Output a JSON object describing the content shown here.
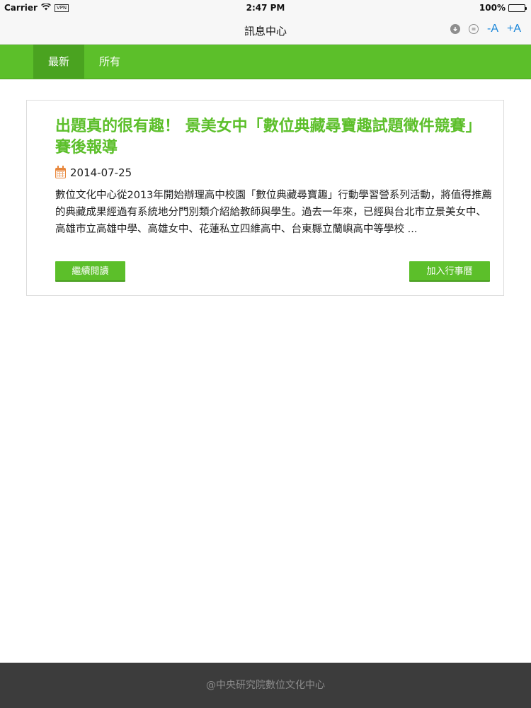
{
  "status_bar": {
    "carrier": "Carrier",
    "vpn": "VPN",
    "time": "2:47 PM",
    "battery": "100%",
    "battery_level": 1.0
  },
  "nav": {
    "title": "訊息中心",
    "font_decrease": "-A",
    "font_increase": "+A",
    "icons": [
      "download-icon",
      "refresh-icon"
    ]
  },
  "tabs": [
    {
      "label": "最新",
      "active": true
    },
    {
      "label": "所有",
      "active": false
    }
  ],
  "article": {
    "title": "出題真的很有趣！ 景美女中「數位典藏尋寶趣試題徵件競賽」賽後報導",
    "date": "2014-07-25",
    "excerpt": "數位文化中心從2013年開始辦理高中校園「數位典藏尋寶趣」行動學習營系列活動，將值得推薦的典藏成果經過有系統地分門別類介紹給教師與學生。過去一年來，已經與台北市立景美女中、高雄市立高雄中學、高雄女中、花蓮私立四維高中、台東縣立蘭嶼高中等學校 ...",
    "read_more": "繼續閱讀",
    "add_calendar": "加入行事曆"
  },
  "footer": {
    "text": "@中央研究院數位文化中心"
  },
  "colors": {
    "accent": "#5cbf2a",
    "tab_active": "#4aa320",
    "link_blue": "#1a86d9",
    "calendar_icon": "#e8873c",
    "footer_bg": "#3c3c3c"
  }
}
